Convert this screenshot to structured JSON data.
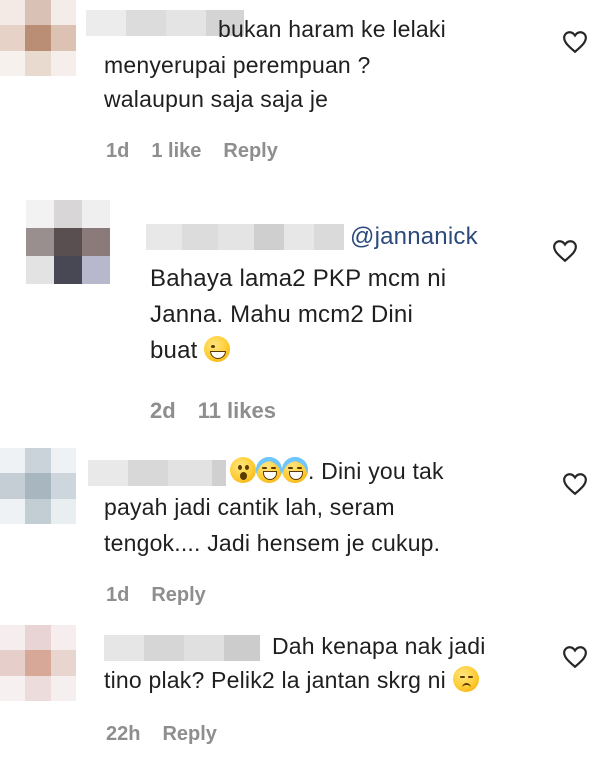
{
  "comments": [
    {
      "lines": [
        "bukan haram ke lelaki",
        "menyerupai perempuan ?",
        "walaupun saja saja je"
      ],
      "time": "1d",
      "likes": "1 like",
      "reply": "Reply"
    },
    {
      "mention": "@jannanick",
      "lines": [
        "Bahaya lama2 PKP mcm ni",
        "Janna. Mahu mcm2 Dini",
        "buat"
      ],
      "emoji": "sweat-smile-emoji",
      "time": "2d",
      "likes": "11 likes"
    },
    {
      "emojis": [
        "astonished-emoji",
        "joy-emoji",
        "joy-emoji"
      ],
      "lines": [
        ". Dini you tak",
        "payah jadi cantik lah, seram",
        "tengok.... Jadi hensem je cukup."
      ],
      "time": "1d",
      "reply": "Reply"
    },
    {
      "lines": [
        "Dah kenapa nak jadi",
        "tino plak? Pelik2 la jantan skrg ni"
      ],
      "emoji": "pensive-emoji",
      "time": "22h",
      "reply": "Reply"
    }
  ],
  "icons": {
    "like": "heart-outline-icon"
  },
  "colors": {
    "text": "#262626",
    "meta": "#8e8e8e",
    "mention": "#2c4a7c"
  }
}
